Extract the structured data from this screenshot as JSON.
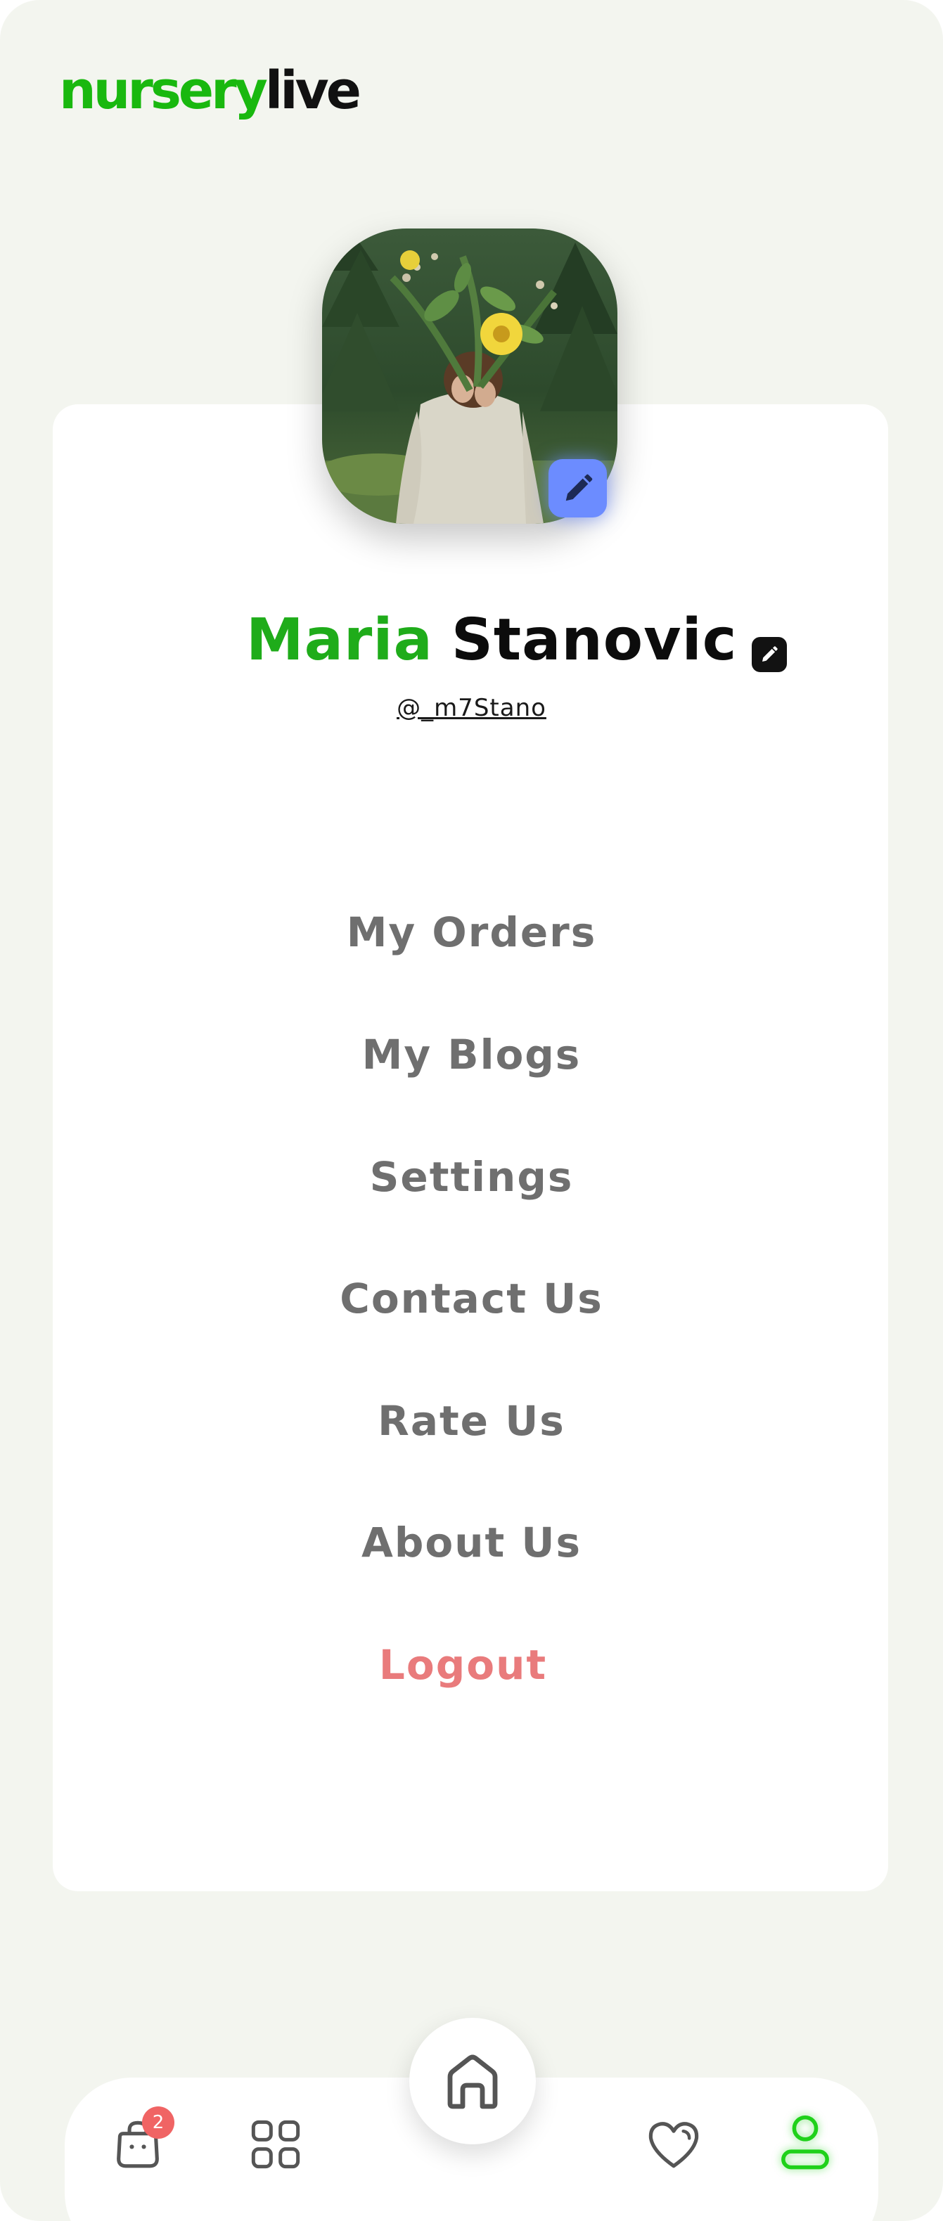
{
  "brand": {
    "logo_part1": "nursery",
    "logo_part2": "live",
    "green": "#19b80f",
    "dark": "#111111"
  },
  "profile": {
    "first_name": "Maria",
    "last_name": "Stanovic",
    "handle": "@_m7Stano",
    "avatar_edit_icon": "pencil-icon",
    "name_edit_icon": "edit-square-icon",
    "first_name_color": "#1fac1a"
  },
  "menu": {
    "items": [
      {
        "label": "My Orders"
      },
      {
        "label": "My Blogs"
      },
      {
        "label": "Settings"
      },
      {
        "label": "Contact Us"
      },
      {
        "label": "Rate Us"
      },
      {
        "label": "About Us"
      }
    ],
    "logout": {
      "label": "Logout",
      "color": "#e97b7c"
    },
    "item_color": "#6f6f6f"
  },
  "bottom_nav": {
    "cart": {
      "icon": "shopping-bag-icon",
      "badge": "2"
    },
    "categories": {
      "icon": "grid-icon"
    },
    "home": {
      "icon": "home-icon"
    },
    "wishlist": {
      "icon": "heart-icon"
    },
    "profile": {
      "icon": "user-icon",
      "active": true,
      "active_color": "#1fd11a"
    }
  },
  "colors": {
    "background": "#f3f5ef",
    "card": "#ffffff",
    "accent_blue": "#6c8cff",
    "badge_red": "#f06464"
  }
}
